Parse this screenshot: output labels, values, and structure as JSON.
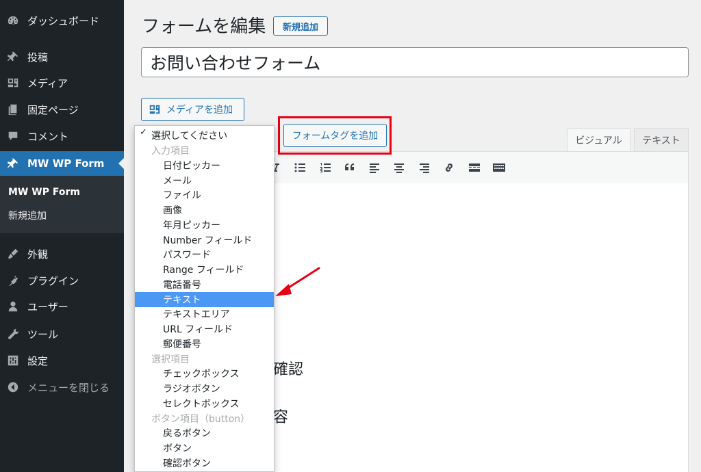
{
  "sidebar": {
    "items": [
      {
        "label": "ダッシュボード",
        "icon": "dashboard-icon"
      },
      {
        "label": "投稿",
        "icon": "pin-icon"
      },
      {
        "label": "メディア",
        "icon": "media-icon"
      },
      {
        "label": "固定ページ",
        "icon": "page-icon"
      },
      {
        "label": "コメント",
        "icon": "comment-icon"
      },
      {
        "label": "MW WP Form",
        "icon": "pin-icon",
        "active": true
      },
      {
        "label": "外観",
        "icon": "brush-icon"
      },
      {
        "label": "プラグイン",
        "icon": "plugin-icon"
      },
      {
        "label": "ユーザー",
        "icon": "user-icon"
      },
      {
        "label": "ツール",
        "icon": "wrench-icon"
      },
      {
        "label": "設定",
        "icon": "settings-icon"
      },
      {
        "label": "メニューを閉じる",
        "icon": "collapse-icon"
      }
    ],
    "submenu": [
      {
        "label": "MW WP Form"
      },
      {
        "label": "新規追加"
      }
    ]
  },
  "header": {
    "title": "フォームを編集",
    "add_new": "新規追加"
  },
  "post_title": {
    "value": "お問い合わせフォーム"
  },
  "editor": {
    "media_button": "メディアを追加",
    "form_tag_button": "フォームタグを追加",
    "tab_visual": "ビジュアル",
    "tab_text": "テキスト",
    "fragments": [
      "確認",
      "容"
    ]
  },
  "dropdown": {
    "options": [
      {
        "label": "選択してください",
        "kind": "selected"
      },
      {
        "label": "入力項目",
        "kind": "group"
      },
      {
        "label": "日付ピッカー"
      },
      {
        "label": "メール"
      },
      {
        "label": "ファイル"
      },
      {
        "label": "画像"
      },
      {
        "label": "年月ピッカー"
      },
      {
        "label": "Number フィールド"
      },
      {
        "label": "パスワード"
      },
      {
        "label": "Range フィールド"
      },
      {
        "label": "電話番号"
      },
      {
        "label": "テキスト",
        "kind": "highlight"
      },
      {
        "label": "テキストエリア"
      },
      {
        "label": "URL フィールド"
      },
      {
        "label": "郵便番号"
      },
      {
        "label": "選択項目",
        "kind": "group"
      },
      {
        "label": "チェックボックス"
      },
      {
        "label": "ラジオボタン"
      },
      {
        "label": "セレクトボックス"
      },
      {
        "label": "ボタン項目（button）",
        "kind": "group"
      },
      {
        "label": "戻るボタン"
      },
      {
        "label": "ボタン"
      },
      {
        "label": "確認ボタン"
      }
    ]
  },
  "colors": {
    "sidebar_bg": "#1d2327",
    "active": "#2271b1",
    "highlight_box": "#e60012",
    "option_highlight": "#4b97f4",
    "arrow": "#e60012"
  }
}
